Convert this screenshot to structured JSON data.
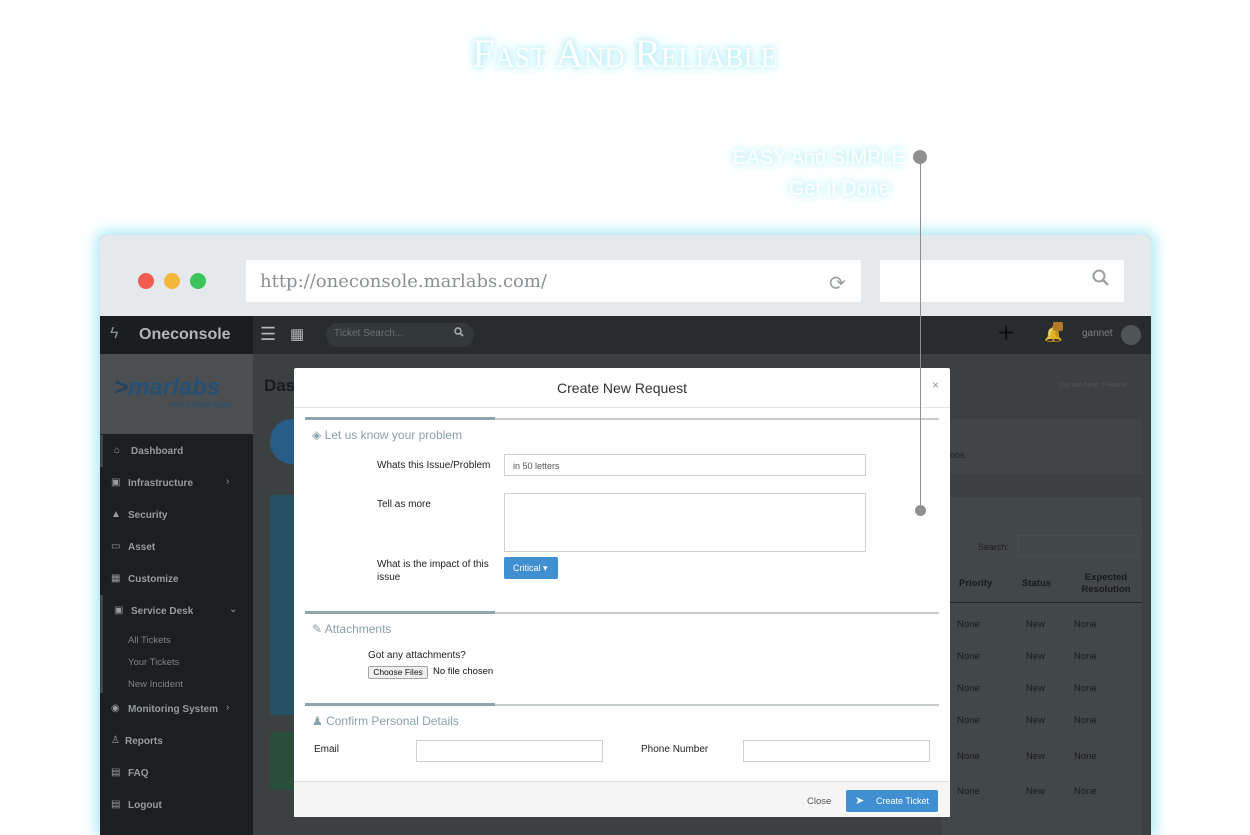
{
  "hero": {
    "headline": "Fast And Reliable",
    "tagline_1": "EASY And SIMPLE",
    "tagline_2": "Get it Done"
  },
  "browser": {
    "url": "http://oneconsole.marlabs.com/",
    "traffic_lights": [
      "#f15b50",
      "#f4b63c",
      "#3cc45c"
    ],
    "reload_icon": "reload-icon",
    "search_icon": "magnifier-icon"
  },
  "app": {
    "brand": "Oneconsole",
    "ticket_search_placeholder": "Ticket Search...",
    "username": "gannet",
    "notification_count": "",
    "accent": "#3f8fd2"
  },
  "sidebar": {
    "logo_text": "marlabs",
    "logo_tagline": "driving digital agility",
    "items": [
      {
        "label": "Dashboard",
        "icon": "home-icon"
      },
      {
        "label": "Infrastructure",
        "icon": "briefcase-icon"
      },
      {
        "label": "Security",
        "icon": "lock-icon"
      },
      {
        "label": "Asset",
        "icon": "laptop-icon"
      },
      {
        "label": "Customize",
        "icon": "grid-icon"
      },
      {
        "label": "Service Desk",
        "icon": "briefcase-icon"
      },
      {
        "label": "Monitoring System",
        "icon": "dashboard-icon"
      },
      {
        "label": "Reports",
        "icon": "user-icon"
      },
      {
        "label": "FAQ",
        "icon": "calendar-icon"
      },
      {
        "label": "Logout",
        "icon": "calendar-icon"
      }
    ],
    "subitems": [
      "All Tickets",
      "Your Tickets",
      "New Incident"
    ]
  },
  "page": {
    "title": "Das",
    "breadcrumb": "You are here: > Home",
    "section_suffix": "S",
    "sub_label": "ions",
    "search_label": "Search:",
    "table_headers": [
      "Priority",
      "Status",
      "Expected Resolution"
    ],
    "table_rows": [
      [
        "None",
        "New",
        "None"
      ],
      [
        "None",
        "New",
        "None"
      ],
      [
        "None",
        "New",
        "None"
      ],
      [
        "None",
        "New",
        "None"
      ],
      [
        "None",
        "New",
        "None"
      ],
      [
        "None",
        "New",
        "None"
      ]
    ]
  },
  "modal": {
    "title": "Create New Request",
    "close_glyph": "×",
    "section_problem": "Let us know your problem",
    "issue_label": "Whats this Issue/Problem",
    "issue_placeholder": "in 50 letters",
    "more_label": "Tell as more",
    "impact_label": "What is the impact of this issue",
    "impact_value": "Critical",
    "section_attachments": "Attachments",
    "attach_label": "Got any attachments?",
    "choose_files": "Choose Files",
    "no_file": "No file chosen",
    "section_personal": "Confirm Personal Details",
    "email_label": "Email",
    "phone_label": "Phone Number",
    "close_label": "Close",
    "create_label": "Create Ticket"
  }
}
